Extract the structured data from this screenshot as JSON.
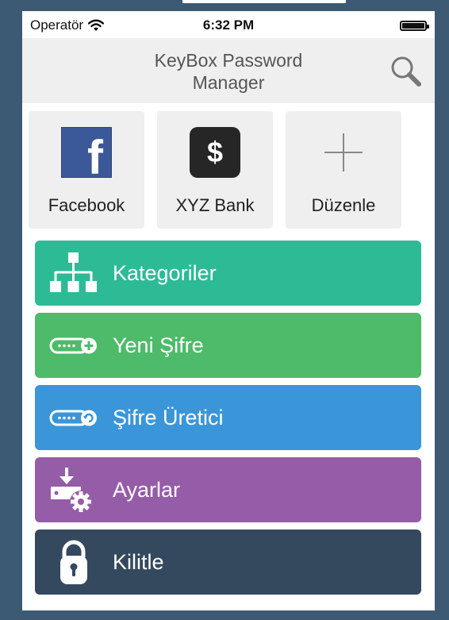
{
  "status_bar": {
    "carrier": "Operatör",
    "time": "6:32 PM"
  },
  "header": {
    "title": "KeyBox Password Manager",
    "search_icon": "search-icon"
  },
  "favorites": [
    {
      "label": "Facebook",
      "icon": "facebook-icon"
    },
    {
      "label": "XYZ Bank",
      "icon": "dollar-icon"
    },
    {
      "label": "Düzenle",
      "icon": "plus-icon"
    }
  ],
  "menu": [
    {
      "label": "Kategoriler",
      "color": "#2dbb95",
      "icon": "hierarchy-icon"
    },
    {
      "label": "Yeni Şifre",
      "color": "#4dbb69",
      "icon": "password-add-icon"
    },
    {
      "label": "Şifre Üretici",
      "color": "#3a96d8",
      "icon": "password-generate-icon"
    },
    {
      "label": "Ayarlar",
      "color": "#955ca8",
      "icon": "settings-import-icon"
    },
    {
      "label": "Kilitle",
      "color": "#34495e",
      "icon": "lock-icon"
    }
  ],
  "colors": {
    "frame": "#3d5a74",
    "navbar_bg": "#efefef",
    "tile_bg": "#efefef"
  }
}
